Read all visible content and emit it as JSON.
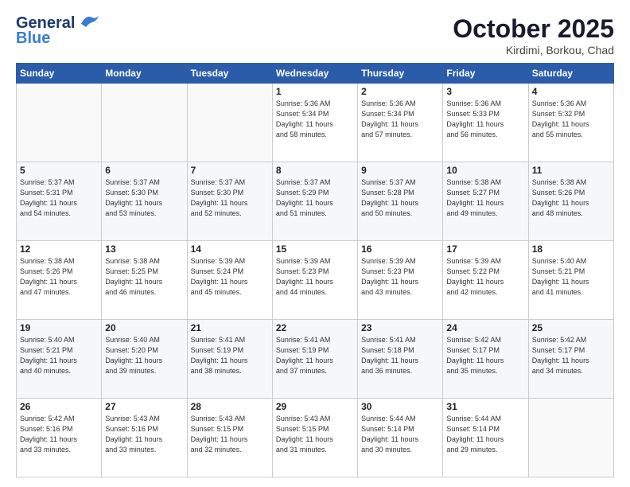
{
  "header": {
    "logo_general": "General",
    "logo_blue": "Blue",
    "month": "October 2025",
    "location": "Kirdimi, Borkou, Chad"
  },
  "weekdays": [
    "Sunday",
    "Monday",
    "Tuesday",
    "Wednesday",
    "Thursday",
    "Friday",
    "Saturday"
  ],
  "weeks": [
    [
      {
        "day": "",
        "info": ""
      },
      {
        "day": "",
        "info": ""
      },
      {
        "day": "",
        "info": ""
      },
      {
        "day": "1",
        "info": "Sunrise: 5:36 AM\nSunset: 5:34 PM\nDaylight: 11 hours\nand 58 minutes."
      },
      {
        "day": "2",
        "info": "Sunrise: 5:36 AM\nSunset: 5:34 PM\nDaylight: 11 hours\nand 57 minutes."
      },
      {
        "day": "3",
        "info": "Sunrise: 5:36 AM\nSunset: 5:33 PM\nDaylight: 11 hours\nand 56 minutes."
      },
      {
        "day": "4",
        "info": "Sunrise: 5:36 AM\nSunset: 5:32 PM\nDaylight: 11 hours\nand 55 minutes."
      }
    ],
    [
      {
        "day": "5",
        "info": "Sunrise: 5:37 AM\nSunset: 5:31 PM\nDaylight: 11 hours\nand 54 minutes."
      },
      {
        "day": "6",
        "info": "Sunrise: 5:37 AM\nSunset: 5:30 PM\nDaylight: 11 hours\nand 53 minutes."
      },
      {
        "day": "7",
        "info": "Sunrise: 5:37 AM\nSunset: 5:30 PM\nDaylight: 11 hours\nand 52 minutes."
      },
      {
        "day": "8",
        "info": "Sunrise: 5:37 AM\nSunset: 5:29 PM\nDaylight: 11 hours\nand 51 minutes."
      },
      {
        "day": "9",
        "info": "Sunrise: 5:37 AM\nSunset: 5:28 PM\nDaylight: 11 hours\nand 50 minutes."
      },
      {
        "day": "10",
        "info": "Sunrise: 5:38 AM\nSunset: 5:27 PM\nDaylight: 11 hours\nand 49 minutes."
      },
      {
        "day": "11",
        "info": "Sunrise: 5:38 AM\nSunset: 5:26 PM\nDaylight: 11 hours\nand 48 minutes."
      }
    ],
    [
      {
        "day": "12",
        "info": "Sunrise: 5:38 AM\nSunset: 5:26 PM\nDaylight: 11 hours\nand 47 minutes."
      },
      {
        "day": "13",
        "info": "Sunrise: 5:38 AM\nSunset: 5:25 PM\nDaylight: 11 hours\nand 46 minutes."
      },
      {
        "day": "14",
        "info": "Sunrise: 5:39 AM\nSunset: 5:24 PM\nDaylight: 11 hours\nand 45 minutes."
      },
      {
        "day": "15",
        "info": "Sunrise: 5:39 AM\nSunset: 5:23 PM\nDaylight: 11 hours\nand 44 minutes."
      },
      {
        "day": "16",
        "info": "Sunrise: 5:39 AM\nSunset: 5:23 PM\nDaylight: 11 hours\nand 43 minutes."
      },
      {
        "day": "17",
        "info": "Sunrise: 5:39 AM\nSunset: 5:22 PM\nDaylight: 11 hours\nand 42 minutes."
      },
      {
        "day": "18",
        "info": "Sunrise: 5:40 AM\nSunset: 5:21 PM\nDaylight: 11 hours\nand 41 minutes."
      }
    ],
    [
      {
        "day": "19",
        "info": "Sunrise: 5:40 AM\nSunset: 5:21 PM\nDaylight: 11 hours\nand 40 minutes."
      },
      {
        "day": "20",
        "info": "Sunrise: 5:40 AM\nSunset: 5:20 PM\nDaylight: 11 hours\nand 39 minutes."
      },
      {
        "day": "21",
        "info": "Sunrise: 5:41 AM\nSunset: 5:19 PM\nDaylight: 11 hours\nand 38 minutes."
      },
      {
        "day": "22",
        "info": "Sunrise: 5:41 AM\nSunset: 5:19 PM\nDaylight: 11 hours\nand 37 minutes."
      },
      {
        "day": "23",
        "info": "Sunrise: 5:41 AM\nSunset: 5:18 PM\nDaylight: 11 hours\nand 36 minutes."
      },
      {
        "day": "24",
        "info": "Sunrise: 5:42 AM\nSunset: 5:17 PM\nDaylight: 11 hours\nand 35 minutes."
      },
      {
        "day": "25",
        "info": "Sunrise: 5:42 AM\nSunset: 5:17 PM\nDaylight: 11 hours\nand 34 minutes."
      }
    ],
    [
      {
        "day": "26",
        "info": "Sunrise: 5:42 AM\nSunset: 5:16 PM\nDaylight: 11 hours\nand 33 minutes."
      },
      {
        "day": "27",
        "info": "Sunrise: 5:43 AM\nSunset: 5:16 PM\nDaylight: 11 hours\nand 33 minutes."
      },
      {
        "day": "28",
        "info": "Sunrise: 5:43 AM\nSunset: 5:15 PM\nDaylight: 11 hours\nand 32 minutes."
      },
      {
        "day": "29",
        "info": "Sunrise: 5:43 AM\nSunset: 5:15 PM\nDaylight: 11 hours\nand 31 minutes."
      },
      {
        "day": "30",
        "info": "Sunrise: 5:44 AM\nSunset: 5:14 PM\nDaylight: 11 hours\nand 30 minutes."
      },
      {
        "day": "31",
        "info": "Sunrise: 5:44 AM\nSunset: 5:14 PM\nDaylight: 11 hours\nand 29 minutes."
      },
      {
        "day": "",
        "info": ""
      }
    ]
  ]
}
